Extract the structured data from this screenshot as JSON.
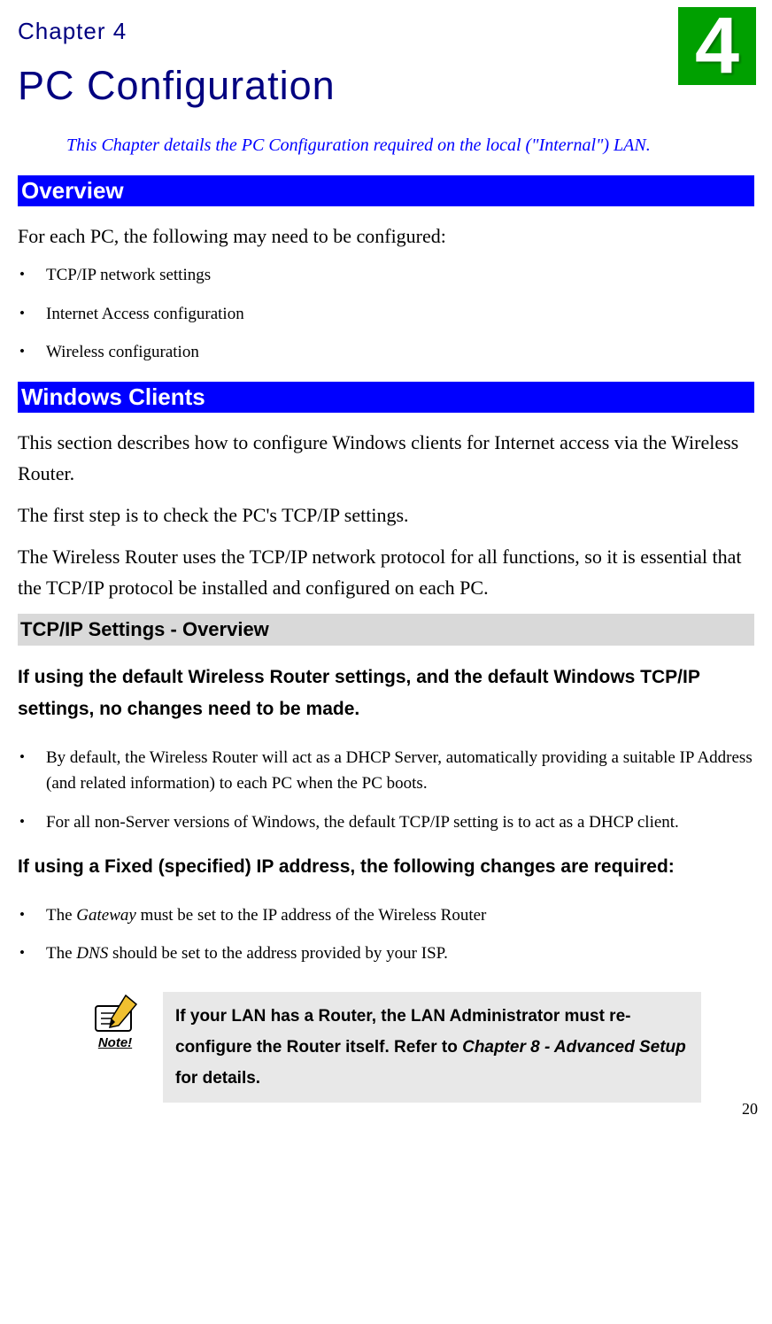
{
  "chapter": {
    "label": "Chapter 4",
    "number": "4",
    "title": "PC Configuration",
    "intro": "This Chapter details the PC Configuration required on the local (\"Internal\") LAN."
  },
  "overview": {
    "heading": "Overview",
    "lead": "For each PC, the following may need to be configured:",
    "items": [
      "TCP/IP network settings",
      "Internet Access configuration",
      "Wireless configuration"
    ]
  },
  "windows_clients": {
    "heading": "Windows Clients",
    "p1": "This section describes how to configure Windows clients for Internet access via the Wireless Router.",
    "p2": "The first step is to check the PC's TCP/IP settings.",
    "p3": "The Wireless Router uses the TCP/IP network protocol for all functions, so it is essential that the TCP/IP protocol be installed and configured on each PC."
  },
  "tcpip": {
    "heading": "TCP/IP Settings - Overview",
    "para1": "If using the default Wireless Router settings, and the default Windows TCP/IP settings, no changes need to be made.",
    "bullets1": [
      "By default, the Wireless Router will act as a DHCP Server, automatically providing a suitable IP Address (and related information) to each PC when the PC boots.",
      "For all non-Server versions of Windows, the default TCP/IP setting is to act as a DHCP client."
    ],
    "para2": "If using a Fixed (specified) IP address, the following changes are required:",
    "bullets2": [
      {
        "prefix": "The ",
        "italic": "Gateway",
        "suffix": " must be set to the IP address of the Wireless Router"
      },
      {
        "prefix": "The ",
        "italic": "DNS",
        "suffix": " should be set to the address provided by your ISP."
      }
    ]
  },
  "note": {
    "icon_label": "Note!",
    "text_pre": "If your LAN has a Router, the LAN Administrator must re-configure the Router itself. Refer to ",
    "ref": "Chapter 8 - Advanced Setup",
    "text_post": " for details."
  },
  "page_number": "20"
}
